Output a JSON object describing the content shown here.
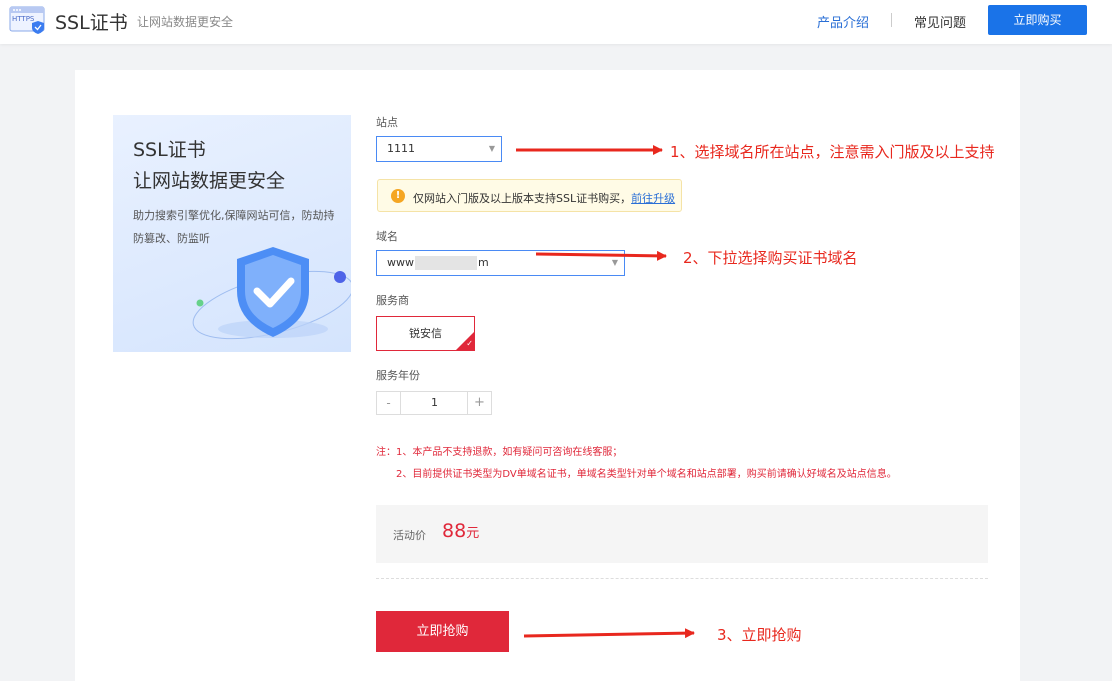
{
  "header": {
    "logo_badge": "HTTPS",
    "title": "SSL证书",
    "subtitle": "让网站数据更安全",
    "nav_intro": "产品介绍",
    "nav_faq": "常见问题",
    "buy_button": "立即购买"
  },
  "banner": {
    "title_line1": "SSL证书",
    "title_line2": "让网站数据更安全",
    "desc_line1": "助力搜索引擎优化,保障网站可信，防劫持",
    "desc_line2": "防篡改、防监听"
  },
  "form": {
    "site_label": "站点",
    "site_value": "1111",
    "notice_text": "仅网站入门版及以上版本支持SSL证书购买，",
    "notice_link": "前往升级",
    "domain_label": "域名",
    "domain_prefix": "www",
    "domain_suffix": "m",
    "provider_label": "服务商",
    "provider_value": "锐安信",
    "years_label": "服务年份",
    "years_minus": "-",
    "years_value": "1",
    "years_plus": "+",
    "note1": "注：1、本产品不支持退款，如有疑问可咨询在线客服；",
    "note2": "2、目前提供证书类型为DV单域名证书，单域名类型针对单个域名和站点部署，购买前请确认好域名及站点信息。",
    "price_label": "活动价",
    "price_value": "88",
    "price_unit": "元",
    "purchase_button": "立即抢购"
  },
  "annotations": {
    "step1": "1、选择域名所在站点，注意需入门版及以上支持",
    "step2": "2、下拉选择购买证书域名",
    "step3": "3、立即抢购"
  },
  "colors": {
    "primary_blue": "#1a73e8",
    "accent_red": "#e0283a",
    "annotation_red": "#e8281e"
  }
}
